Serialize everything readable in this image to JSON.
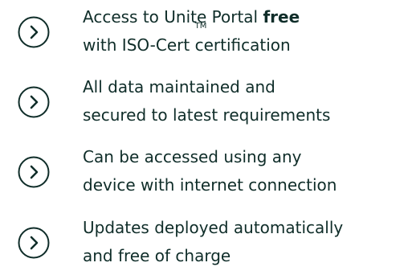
{
  "features": [
    {
      "icon": "chevron-right-circle-icon",
      "line1_text": "Access to Unite Portal ",
      "line1_bold": "free",
      "line2_pre": "with ISO-Cert",
      "line2_tm": "TM",
      "line2_post": "certification"
    },
    {
      "icon": "chevron-right-circle-icon",
      "line1": "All data maintained and",
      "line2": "secured to latest requirements"
    },
    {
      "icon": "chevron-right-circle-icon",
      "line1": "Can be accessed using any",
      "line2": "device with internet connection"
    },
    {
      "icon": "chevron-right-circle-icon",
      "line1": "Updates deployed automatically",
      "line2": "and free of charge"
    }
  ],
  "colors": {
    "text": "#0f2d29",
    "icon": "#0f2d29",
    "background": "#ffffff"
  }
}
